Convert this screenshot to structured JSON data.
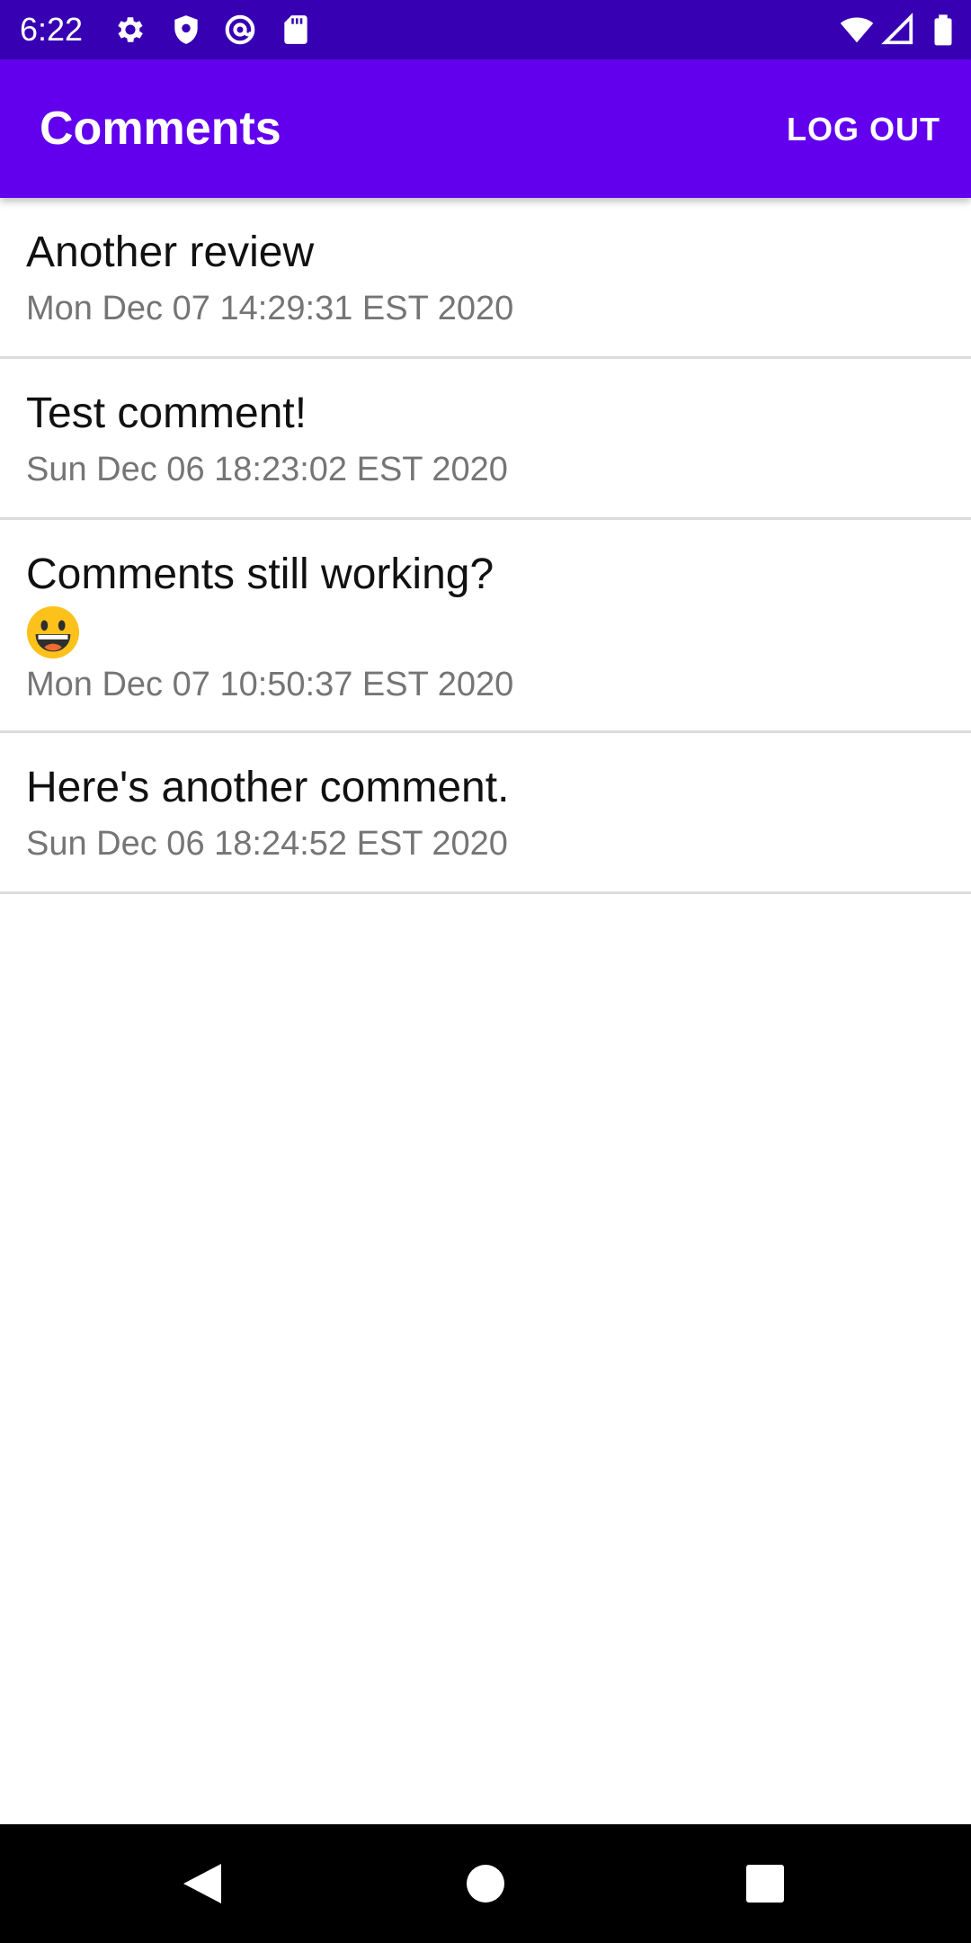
{
  "status_bar": {
    "time": "6:22",
    "left_icons": [
      "gear-icon",
      "shield-icon",
      "at-sign-icon",
      "sd-card-icon"
    ],
    "right_icons": [
      "wifi-icon",
      "signal-icon",
      "battery-icon"
    ]
  },
  "app_bar": {
    "title": "Comments",
    "logout_label": "LOG OUT"
  },
  "comments": [
    {
      "text": "Another review",
      "date": "Mon Dec 07 14:29:31 EST 2020"
    },
    {
      "text": "Test comment!",
      "date": "Sun Dec 06 18:23:02 EST 2020"
    },
    {
      "text": "Comments still working?",
      "emoji": "grinning-face-emoji",
      "date": "Mon Dec 07 10:50:37 EST 2020"
    },
    {
      "text": "Here's another comment.",
      "date": "Sun Dec 06 18:24:52 EST 2020"
    }
  ],
  "nav_bar": {
    "buttons": [
      "back-icon",
      "home-icon",
      "recents-icon"
    ]
  },
  "colors": {
    "status_bar": "#3700b3",
    "app_bar": "#6200ee",
    "divider": "#dcdcdc",
    "secondary_text": "#757575"
  }
}
